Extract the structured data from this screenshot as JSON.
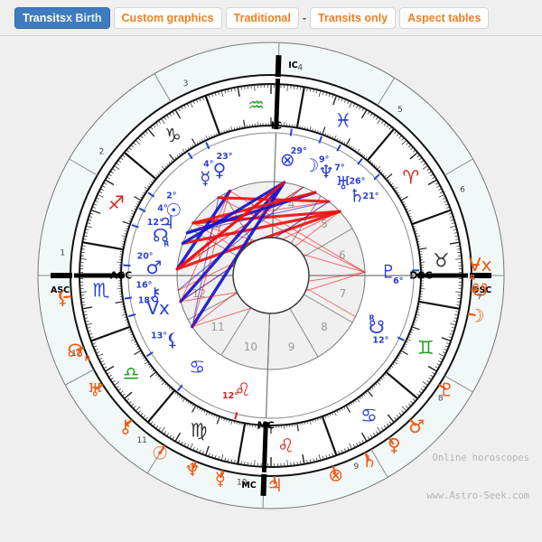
{
  "tabs": [
    {
      "label": "Transits",
      "label2": " x Birth",
      "active": true,
      "name": "tab-transits-x-birth"
    },
    {
      "label": "Custom graphics",
      "label2": "",
      "active": false,
      "name": "tab-custom-graphics"
    },
    {
      "label": "Traditional",
      "label2": "",
      "active": false,
      "name": "tab-traditional"
    },
    {
      "label": "Transits only",
      "label2": "",
      "active": false,
      "name": "tab-transits-only"
    },
    {
      "label": "Aspect tables",
      "label2": "",
      "active": false,
      "name": "tab-aspect-tables"
    }
  ],
  "tab_separator": "-",
  "watermark": {
    "line1": "Online horoscopes",
    "line2": "www.Astro-Seek.com"
  },
  "colors": {
    "active_tab_bg": "#3f7bbf",
    "tab_text": "#f08020",
    "transit_planet": "#f05a14",
    "natal_planet": "#2b3fd0",
    "aspect_red": "#ee1111",
    "aspect_blue": "#1414cc",
    "fire_sign": "#e02020",
    "earth_sign": "#333333",
    "air_sign": "#1f9f1f",
    "water_sign": "#2b3fd0",
    "ring_fill": "#f2f8f8",
    "page_bg": "#efefef"
  },
  "chart": {
    "angles": [
      {
        "name": "ASC",
        "label": "ASC",
        "deg": 6
      },
      {
        "name": "MC",
        "label": "MC",
        "deg": 278
      },
      {
        "name": "DSC",
        "label": "DSC",
        "deg": 186
      },
      {
        "name": "IC",
        "label": "IC",
        "deg": 98
      },
      {
        "name": "ASC-outer",
        "label": "ASC",
        "deg": 6
      },
      {
        "name": "MC-outer",
        "label": "MC",
        "deg": 278
      },
      {
        "name": "DSC-outer",
        "label": "DSC",
        "deg": 186
      },
      {
        "name": "IC-outer",
        "label": "IC",
        "deg": 98
      }
    ],
    "house_numbers": [
      "1",
      "2",
      "3",
      "4",
      "5",
      "6",
      "7",
      "8",
      "9",
      "10",
      "11",
      "12"
    ],
    "outer_house_numbers": [
      "1",
      "2",
      "3",
      "4",
      "5",
      "6",
      "7",
      "8",
      "9",
      "10",
      "11",
      "12"
    ],
    "zodiac_signs": [
      {
        "name": "aries",
        "glyph": "♈",
        "element": "fire"
      },
      {
        "name": "taurus",
        "glyph": "♉",
        "element": "earth"
      },
      {
        "name": "gemini",
        "glyph": "♊",
        "element": "air"
      },
      {
        "name": "cancer",
        "glyph": "♋",
        "element": "water"
      },
      {
        "name": "leo",
        "glyph": "♌",
        "element": "fire"
      },
      {
        "name": "virgo",
        "glyph": "♍",
        "element": "earth"
      },
      {
        "name": "libra",
        "glyph": "♎",
        "element": "air"
      },
      {
        "name": "scorpio",
        "glyph": "♏",
        "element": "water"
      },
      {
        "name": "sagittarius",
        "glyph": "♐",
        "element": "fire"
      },
      {
        "name": "capricorn",
        "glyph": "♑",
        "element": "earth"
      },
      {
        "name": "aquarius",
        "glyph": "♒",
        "element": "air"
      },
      {
        "name": "pisces",
        "glyph": "♓",
        "element": "water"
      }
    ],
    "natal_planets": [
      {
        "name": "leo-cusp-marker",
        "glyph": "♌",
        "degree": "12°",
        "deg": 290,
        "color": "fire"
      },
      {
        "name": "cancer-marker",
        "glyph": "♋",
        "degree": "",
        "deg": 315,
        "color": "water"
      },
      {
        "name": "lilith",
        "glyph": "⚸",
        "degree": "13°",
        "deg": 333,
        "color": "natal"
      },
      {
        "name": "vertex",
        "glyph": "Vx",
        "degree": "18°",
        "deg": 350,
        "color": "natal"
      },
      {
        "name": "chiron",
        "glyph": "⚷",
        "degree": "16°",
        "deg": 357,
        "color": "natal"
      },
      {
        "name": "mars",
        "glyph": "♂",
        "degree": "20°",
        "deg": 10,
        "color": "natal"
      },
      {
        "name": "north-node",
        "glyph": "☊",
        "degree": "12°",
        "deg": 26,
        "color": "natal",
        "retro": "R"
      },
      {
        "name": "jupiter",
        "glyph": "♃",
        "degree": "4°",
        "deg": 33,
        "color": "natal"
      },
      {
        "name": "sun",
        "glyph": "☉",
        "degree": "2°",
        "deg": 40,
        "color": "natal"
      },
      {
        "name": "mercury",
        "glyph": "☿",
        "degree": "4°",
        "deg": 62,
        "color": "natal"
      },
      {
        "name": "venus",
        "glyph": "♀",
        "degree": "23°",
        "deg": 70,
        "color": "natal"
      },
      {
        "name": "part-of-fortune",
        "glyph": "⊗",
        "degree": "29°",
        "deg": 104,
        "color": "natal"
      },
      {
        "name": "moon",
        "glyph": "☽",
        "degree": "9°",
        "deg": 116,
        "color": "natal"
      },
      {
        "name": "neptune",
        "glyph": "♆",
        "degree": "7°",
        "deg": 124,
        "color": "natal"
      },
      {
        "name": "uranus",
        "glyph": "♅",
        "degree": "26°",
        "deg": 134,
        "color": "natal"
      },
      {
        "name": "saturn",
        "glyph": "♄",
        "degree": "21°",
        "deg": 143,
        "color": "natal"
      },
      {
        "name": "pluto",
        "glyph": "♇",
        "degree": "6°",
        "deg": 184,
        "color": "natal"
      },
      {
        "name": "south-node",
        "glyph": "☋",
        "degree": "12°",
        "deg": 212,
        "color": "natal",
        "retro": "R"
      }
    ],
    "transit_planets": [
      {
        "name": "t-lilith",
        "glyph": "⚸",
        "deg": 0
      },
      {
        "name": "t-north-node",
        "glyph": "☊",
        "deg": 345,
        "retro": "R"
      },
      {
        "name": "t-uranus",
        "glyph": "♅",
        "deg": 333
      },
      {
        "name": "t-chiron",
        "glyph": "⚷",
        "deg": 320
      },
      {
        "name": "t-sun",
        "glyph": "☉",
        "deg": 308
      },
      {
        "name": "t-neptune",
        "glyph": "♆",
        "deg": 298
      },
      {
        "name": "t-mercury",
        "glyph": "☿",
        "deg": 290
      },
      {
        "name": "t-jupiter",
        "glyph": "♃",
        "deg": 275
      },
      {
        "name": "t-pof",
        "glyph": "⊗",
        "deg": 258
      },
      {
        "name": "t-saturn",
        "glyph": "♄",
        "deg": 248
      },
      {
        "name": "t-venus",
        "glyph": "♀",
        "deg": 240
      },
      {
        "name": "t-mars",
        "glyph": "♂",
        "deg": 232
      },
      {
        "name": "t-pluto",
        "glyph": "♇",
        "deg": 219
      },
      {
        "name": "t-moon",
        "glyph": "☽",
        "deg": 197
      },
      {
        "name": "t-south-node",
        "glyph": "☋",
        "deg": 190,
        "retro": "R"
      },
      {
        "name": "t-vertex",
        "glyph": "Vx",
        "deg": 183
      }
    ]
  }
}
